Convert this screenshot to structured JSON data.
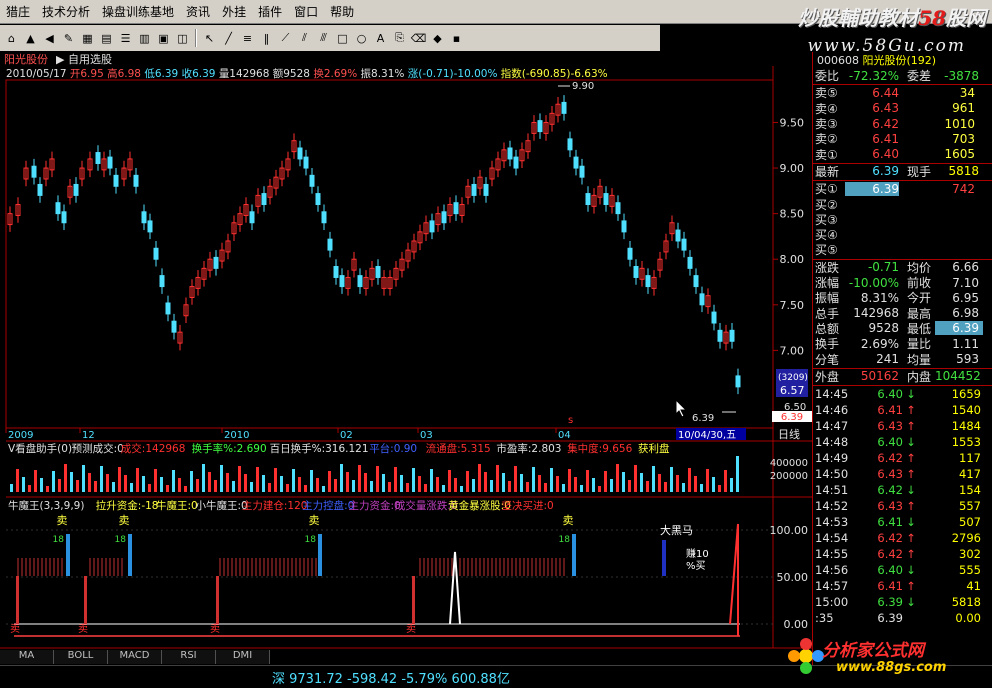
{
  "menu": [
    "猎庄",
    "技术分析",
    "操盘训练基地",
    "资讯",
    "外挂",
    "插件",
    "窗口",
    "帮助"
  ],
  "watermark": {
    "text1": "炒股輔助教材",
    "text_red": "58",
    "text2": "股网",
    "sub": "www.58Gu.com"
  },
  "tabs": {
    "stock": "阳光股份",
    "custom": "自用选股"
  },
  "info_line": {
    "date": "2010/05/17",
    "open": "开6.95",
    "high": "高6.98",
    "low": "低6.39",
    "close": "收6.39",
    "vol": "量142968",
    "amount": "额9528",
    "turnover": "换2.69%",
    "amplitude": "振8.31%",
    "change": "涨(-0.71)-10.00%",
    "index": "指数(-690.85)-6.63%"
  },
  "price_axis": [
    "9.50",
    "9.00",
    "8.50",
    "8.00",
    "7.50",
    "7.00"
  ],
  "price_labels": {
    "high_mark": "9.90",
    "low_mark": "6.39",
    "cursor_box": "(3209)",
    "cursor_val": "6.57",
    "cursor_val2": "6.50",
    "last": "6.39"
  },
  "date_axis": [
    "2009",
    "12",
    "2010",
    "02",
    "03",
    "04"
  ],
  "date_current": "10/04/30,五",
  "period": "日线",
  "vol_indicator": {
    "name": "V看盘助手(0)",
    "items": [
      "预测成交:0",
      "成交:142968",
      "换手率%:2.690",
      "百日换手%:316.121",
      "平台:0.90",
      "流通盘:5.315",
      "市盈率:2.803",
      "集中度:9.656",
      "获利盘"
    ]
  },
  "vol_axis": [
    "400000",
    "200000"
  ],
  "lower_indicator": {
    "name": "牛魔王(3,3,9,9)",
    "items": [
      "拉升资金:-18",
      "牛魔王:0",
      "小牛魔王:0",
      "主力建仓:120",
      "主力控盘:0",
      "主力资金:0",
      "成交量涨跌:0",
      "黄金暴涨股:0",
      "坚决买进:0"
    ]
  },
  "lower_axis": [
    "100.00",
    "50.00",
    "0.00"
  ],
  "lower_labels": {
    "sell": "卖",
    "buy": "买",
    "big_horse": "大黑马",
    "earn": "赚10",
    "earn2": "%买"
  },
  "bottom_tabs": [
    "MA",
    "BOLL",
    "MACD",
    "RSI",
    "DMI"
  ],
  "status": {
    "index": "深 9731.72 -598.42 -5.79% 600.88亿"
  },
  "right_panel": {
    "code": "000608",
    "name": "阳光股份(192)",
    "wei_bi": {
      "label": "委比",
      "value": "-72.32%",
      "label2": "委差",
      "value2": "-3878"
    },
    "sells": [
      {
        "label": "卖⑤",
        "price": "6.44",
        "vol": "34"
      },
      {
        "label": "卖④",
        "price": "6.43",
        "vol": "961"
      },
      {
        "label": "卖③",
        "price": "6.42",
        "vol": "1010"
      },
      {
        "label": "卖②",
        "price": "6.41",
        "vol": "703"
      },
      {
        "label": "卖①",
        "price": "6.40",
        "vol": "1605"
      }
    ],
    "latest": {
      "label": "最新",
      "price": "6.39",
      "label2": "现手",
      "vol": "5818"
    },
    "buys": [
      {
        "label": "买①",
        "price": "6.39",
        "vol": "742"
      },
      {
        "label": "买②",
        "price": "",
        "vol": ""
      },
      {
        "label": "买③",
        "price": "",
        "vol": ""
      },
      {
        "label": "买④",
        "price": "",
        "vol": ""
      },
      {
        "label": "买⑤",
        "price": "",
        "vol": ""
      }
    ],
    "stats": [
      {
        "l1": "涨跌",
        "v1": "-0.71",
        "l2": "均价",
        "v2": "6.66"
      },
      {
        "l1": "涨幅",
        "v1": "-10.00%",
        "l2": "前收",
        "v2": "7.10"
      },
      {
        "l1": "振幅",
        "v1": "8.31%",
        "l2": "今开",
        "v2": "6.95"
      },
      {
        "l1": "总手",
        "v1": "142968",
        "l2": "最高",
        "v2": "6.98"
      },
      {
        "l1": "总额",
        "v1": "9528",
        "l2": "最低",
        "v2": "6.39"
      },
      {
        "l1": "换手",
        "v1": "2.69%",
        "l2": "量比",
        "v2": "1.11"
      },
      {
        "l1": "分笔",
        "v1": "241",
        "l2": "均量",
        "v2": "593"
      }
    ],
    "outer": {
      "label": "外盘",
      "value": "50162",
      "label2": "内盘",
      "value2": "104452"
    },
    "ticks": [
      {
        "t": "14:45",
        "p": "6.40",
        "d": "dn",
        "v": "1659"
      },
      {
        "t": "14:46",
        "p": "6.41",
        "d": "up",
        "v": "1540"
      },
      {
        "t": "14:47",
        "p": "6.43",
        "d": "up",
        "v": "1484"
      },
      {
        "t": "14:48",
        "p": "6.40",
        "d": "dn",
        "v": "1553"
      },
      {
        "t": "14:49",
        "p": "6.42",
        "d": "up",
        "v": "117"
      },
      {
        "t": "14:50",
        "p": "6.43",
        "d": "up",
        "v": "417"
      },
      {
        "t": "14:51",
        "p": "6.42",
        "d": "dn",
        "v": "154"
      },
      {
        "t": "14:52",
        "p": "6.43",
        "d": "up",
        "v": "557"
      },
      {
        "t": "14:53",
        "p": "6.41",
        "d": "dn",
        "v": "507"
      },
      {
        "t": "14:54",
        "p": "6.42",
        "d": "up",
        "v": "2796"
      },
      {
        "t": "14:55",
        "p": "6.42",
        "d": "up",
        "v": "302"
      },
      {
        "t": "14:56",
        "p": "6.40",
        "d": "dn",
        "v": "555"
      },
      {
        "t": "14:57",
        "p": "6.41",
        "d": "up",
        "v": "41"
      },
      {
        "t": "15:00",
        "p": "6.39",
        "d": "dn",
        "v": "5818"
      },
      {
        "t": ":35",
        "p": "6.39",
        "d": "",
        "v": "0.00"
      }
    ]
  },
  "logo": {
    "t1": "分析家公式网",
    "t2": "www.88gs.com"
  },
  "colors": {
    "up": "#ff4040",
    "down": "#50e0ff",
    "bg": "#000000",
    "grid": "#aa0000"
  }
}
